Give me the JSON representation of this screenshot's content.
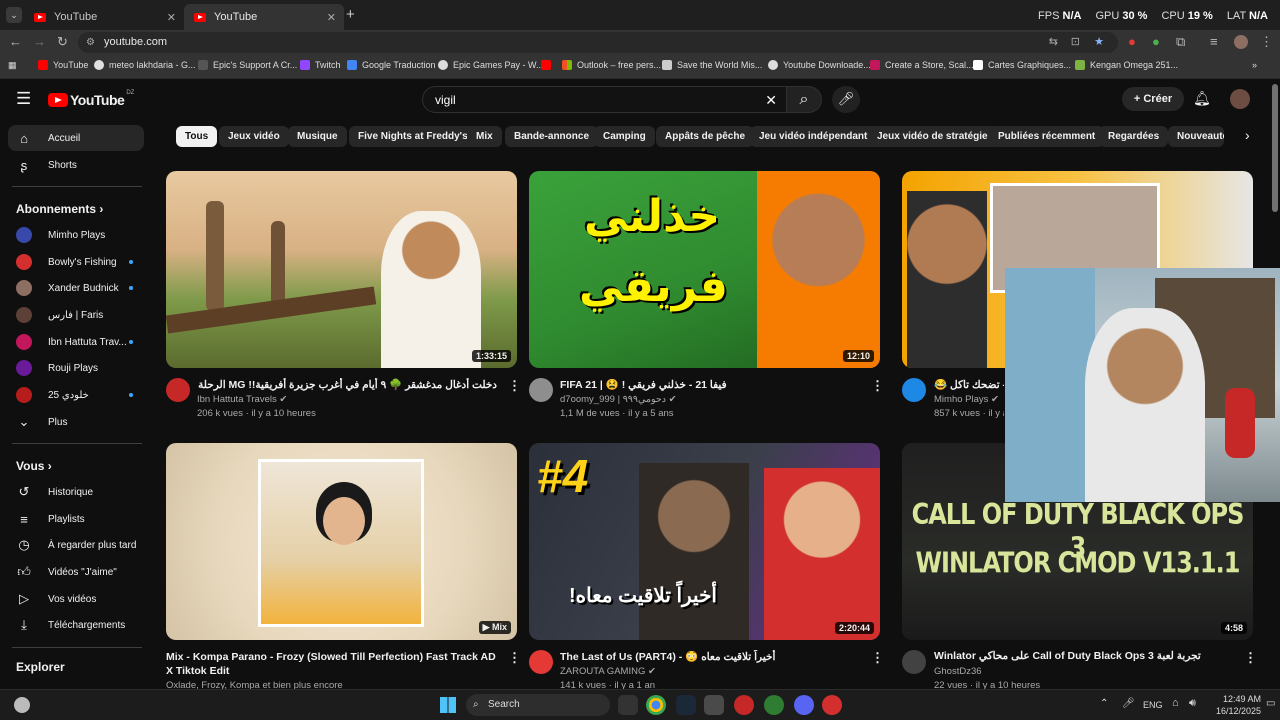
{
  "browser": {
    "tabs": [
      {
        "label": "YouTube"
      },
      {
        "label": "YouTube"
      }
    ],
    "url": "youtube.com",
    "overlay": {
      "fps_label": "FPS",
      "fps": "N/A",
      "gpu_label": "GPU",
      "gpu": "30 %",
      "cpu_label": "CPU",
      "cpu": "19 %",
      "lat_label": "LAT",
      "lat": "N/A"
    },
    "bookmarks": [
      {
        "label": "YouTube"
      },
      {
        "label": "meteo lakhdaria - G..."
      },
      {
        "label": "Epic's Support A Cr..."
      },
      {
        "label": "Twitch"
      },
      {
        "label": "Google Traduction"
      },
      {
        "label": "Epic Games Pay - W..."
      },
      {
        "label": "Outlook – free pers..."
      },
      {
        "label": "Save the World Mis..."
      },
      {
        "label": "Youtube Downloade..."
      },
      {
        "label": "Create a Store, Scal..."
      },
      {
        "label": "Cartes Graphiques..."
      },
      {
        "label": "Kengan Omega 251..."
      }
    ]
  },
  "youtube": {
    "logo_text": "YouTube",
    "region": "DZ",
    "search_value": "vigil",
    "create_label": "Créer",
    "chips": [
      "Tous",
      "Jeux vidéo",
      "Musique",
      "Five Nights at Freddy's",
      "Mix",
      "Bande-annonce",
      "Camping",
      "Appâts de pêche",
      "Jeu vidéo indépendant",
      "Jeux vidéo de stratégie",
      "Publiées récemment",
      "Regardées",
      "Nouveautés"
    ],
    "sidebar": {
      "main": [
        {
          "label": "Accueil"
        },
        {
          "label": "Shorts"
        }
      ],
      "subs_title": "Abonnements",
      "subs": [
        {
          "label": "Mimho Plays"
        },
        {
          "label": "Bowly's Fishing"
        },
        {
          "label": "Xander Budnick"
        },
        {
          "label": "فارس | Faris"
        },
        {
          "label": "Ibn Hattuta Trav..."
        },
        {
          "label": "Rouji Plays"
        },
        {
          "label": "خلودي 25"
        },
        {
          "label": "Plus"
        }
      ],
      "you_title": "Vous",
      "you": [
        {
          "label": "Historique"
        },
        {
          "label": "Playlists"
        },
        {
          "label": "À regarder plus tard"
        },
        {
          "label": "Vidéos \"J'aime\""
        },
        {
          "label": "Vos vidéos"
        },
        {
          "label": "Téléchargements"
        }
      ],
      "explore_title": "Explorer"
    },
    "videos": [
      {
        "title": "دخلت أدغال مدغشقر 🌳 ٩ أيام في أغرب جزيرة أفريقية!! MG الرحلة كاملة",
        "channel": "Ibn Hattuta Travels",
        "meta": "206 k vues · il y a 10 heures",
        "duration": "1:33:15"
      },
      {
        "title": "FIFA 21 | 😫 ! فيفا 21 - خذلني فريقي",
        "channel": "d7oomy_999 | دحومي٩٩٩",
        "meta": "1,1 M de vues · il y a 5 ans",
        "duration": "12:10",
        "thumb_text_1": "خذلني",
        "thumb_text_2": "فريقي"
      },
      {
        "title": "😂 تحدي - تضحك تاكل",
        "channel": "Mimho Plays",
        "meta": "857 k vues · il y a",
        "duration": ""
      },
      {
        "title": "Mix - Kompa Parano - Frozy (Slowed Till Perfection) Fast Track AD X Tiktok Edit",
        "channel": "Oxlade, Frozy, Kompa et bien plus encore",
        "meta": "",
        "duration": "Mix"
      },
      {
        "title": "The Last of Us (PART4) - 😳 أخيراً تلاقيت معاه",
        "channel": "ZAROUTA GAMING",
        "meta": "141 k vues · il y a 1 an",
        "duration": "2:20:44",
        "thumb_text_1": "#4",
        "thumb_text_2": "أخيراً تلاقيت معاه!"
      },
      {
        "title": "Winlator على محاكي Call of Duty Black Ops 3 تجربة لعبة",
        "channel": "GhostDz36",
        "meta": "22 vues · il y a 10 heures",
        "duration": "4:58",
        "thumb_text_1": "CALL OF DUTY BLACK OPS 3",
        "thumb_text_2": "WINLATOR CMOD V13.1.1"
      }
    ]
  },
  "taskbar": {
    "search_placeholder": "Search",
    "lang": "ENG",
    "time": "12:49 AM",
    "date": "16/12/2025"
  },
  "colors": {
    "brand_red": "#ff0000",
    "accent_blue": "#3ea6ff"
  }
}
